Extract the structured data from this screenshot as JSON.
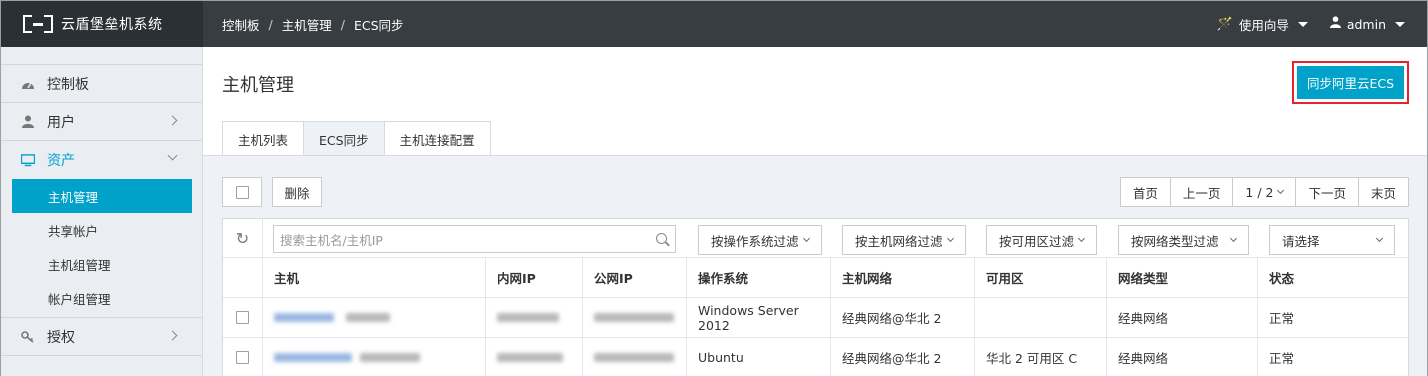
{
  "app": {
    "title": "云盾堡垒机系统"
  },
  "breadcrumb": [
    "控制板",
    "主机管理",
    "ECS同步"
  ],
  "header": {
    "guide_label": "使用向导",
    "user_label": "admin"
  },
  "sidebar": {
    "items": [
      {
        "label": "控制板",
        "icon": "dashboard-icon"
      },
      {
        "label": "用户",
        "icon": "user-icon"
      },
      {
        "label": "资产",
        "icon": "monitor-icon",
        "expanded": true
      },
      {
        "label": "授权",
        "icon": "key-icon"
      }
    ],
    "asset_sub": [
      "主机管理",
      "共享帐户",
      "主机组管理",
      "帐户组管理"
    ],
    "selected_sub": "主机管理"
  },
  "main": {
    "title": "主机管理",
    "sync_button": "同步阿里云ECS",
    "tabs": [
      "主机列表",
      "ECS同步",
      "主机连接配置"
    ],
    "active_tab": "ECS同步"
  },
  "toolbar": {
    "delete_label": "删除",
    "pager": {
      "first": "首页",
      "prev": "上一页",
      "page": "1 / 2",
      "next": "下一页",
      "last": "末页"
    }
  },
  "filters": {
    "search_placeholder": "搜索主机名/主机IP",
    "os": "按操作系统过滤",
    "network": "按主机网络过滤",
    "zone": "按可用区过滤",
    "net_type": "按网络类型过滤",
    "status": "请选择"
  },
  "table": {
    "columns": [
      "主机",
      "内网IP",
      "公网IP",
      "操作系统",
      "主机网络",
      "可用区",
      "网络类型",
      "状态"
    ],
    "rows": [
      {
        "os": "Windows Server 2012",
        "network": "经典网络@华北 2",
        "zone": "",
        "net_type": "经典网络",
        "status": "正常"
      },
      {
        "os": "Ubuntu",
        "network": "经典网络@华北 2",
        "zone": "华北 2 可用区 C",
        "net_type": "经典网络",
        "status": "正常"
      }
    ]
  },
  "colors": {
    "accent": "#00a2ca",
    "topbar": "#373d41",
    "highlight_border": "#e3242b"
  }
}
